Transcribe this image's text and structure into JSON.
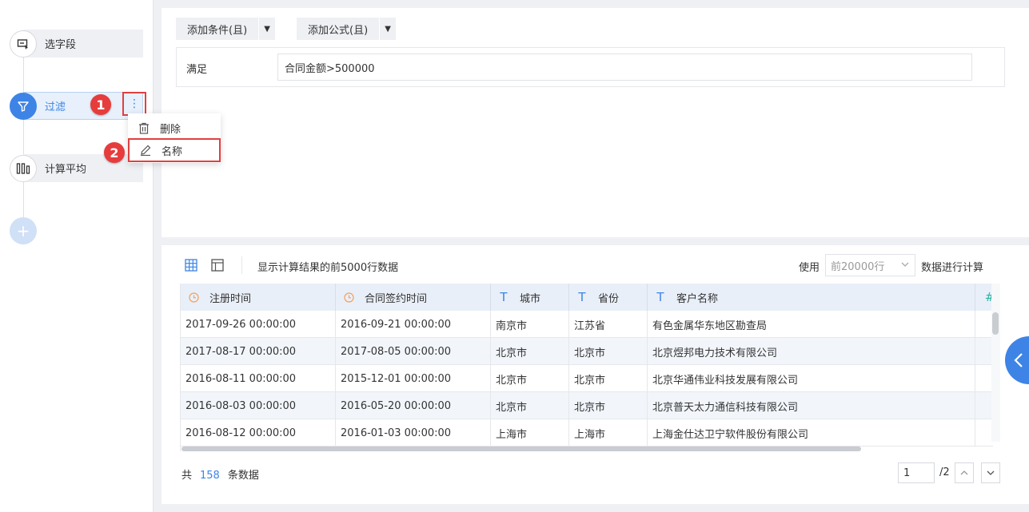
{
  "pipeline": {
    "steps": [
      {
        "label": "选字段",
        "icon": "select-field-icon"
      },
      {
        "label": "过滤",
        "icon": "filter-icon"
      },
      {
        "label": "计算平均",
        "icon": "average-columns-icon"
      }
    ],
    "more_icon": "more-vertical-icon",
    "add_icon": "plus-icon"
  },
  "annotations": [
    "1",
    "2"
  ],
  "context_menu": {
    "items": [
      {
        "label": "删除",
        "icon": "trash-icon"
      },
      {
        "label": "名称",
        "icon": "pencil-icon"
      }
    ]
  },
  "filter": {
    "add_condition": "添加条件(且)",
    "add_formula": "添加公式(且)",
    "satisfy_label": "满足",
    "condition": "合同金额>500000"
  },
  "data_panel": {
    "info": "显示计算结果的前5000行数据",
    "use_label": "使用",
    "row_limit": "前20000行",
    "calc_label": "数据进行计算",
    "columns": [
      {
        "label": "注册时间",
        "type": "clock-icon"
      },
      {
        "label": "合同签约时间",
        "type": "clock-icon"
      },
      {
        "label": "城市",
        "type": "text-type-icon"
      },
      {
        "label": "省份",
        "type": "text-type-icon"
      },
      {
        "label": "客户名称",
        "type": "text-type-icon"
      },
      {
        "label": "#",
        "type": "number-type-icon"
      }
    ],
    "rows": [
      [
        "2017-09-26 00:00:00",
        "2016-09-21 00:00:00",
        "南京市",
        "江苏省",
        "有色金属华东地区勘查局"
      ],
      [
        "2017-08-17 00:00:00",
        "2017-08-05 00:00:00",
        "北京市",
        "北京市",
        "北京煜邦电力技术有限公司"
      ],
      [
        "2016-08-11 00:00:00",
        "2015-12-01 00:00:00",
        "北京市",
        "北京市",
        "北京华通伟业科技发展有限公司"
      ],
      [
        "2016-08-03 00:00:00",
        "2016-05-20 00:00:00",
        "北京市",
        "北京市",
        "北京普天太力通信科技有限公司"
      ],
      [
        "2016-08-12 00:00:00",
        "2016-01-03 00:00:00",
        "上海市",
        "上海市",
        "上海金仕达卫宁软件股份有限公司"
      ]
    ],
    "footer": {
      "total_prefix": "共",
      "total_count": "158",
      "total_suffix": "条数据",
      "page": "1",
      "page_total": "/2"
    }
  },
  "colors": {
    "accent": "#3d84e6",
    "annotation": "#e63c3c",
    "clock": "#f0a060"
  }
}
